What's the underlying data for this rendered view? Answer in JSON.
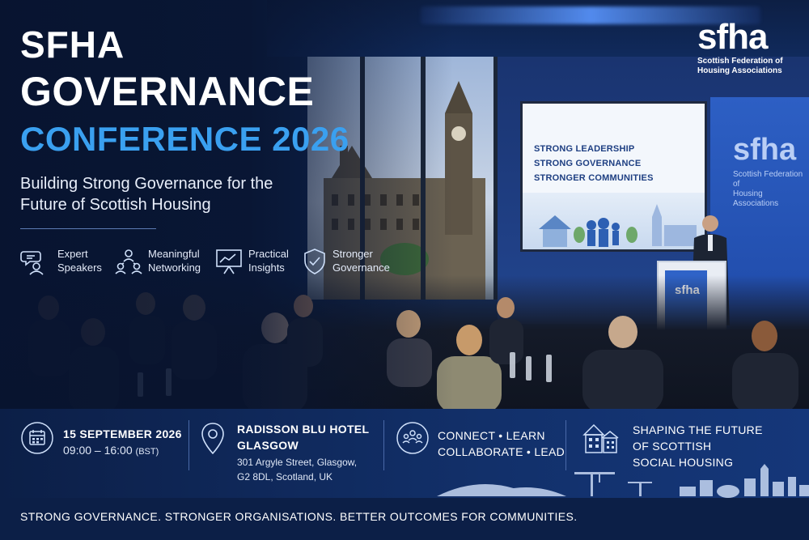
{
  "header": {
    "title_line1": "SFHA",
    "title_line2": "GOVERNANCE",
    "title_line3": "CONFERENCE 2026",
    "subtitle": "Building Strong Governance for the Future of Scottish Housing"
  },
  "features": [
    {
      "icon": "speakers-icon",
      "line1": "Expert",
      "line2": "Speakers"
    },
    {
      "icon": "network-icon",
      "line1": "Meaningful",
      "line2": "Networking"
    },
    {
      "icon": "presentation-icon",
      "line1": "Practical",
      "line2": "Insights"
    },
    {
      "icon": "shield-check-icon",
      "line1": "Stronger",
      "line2": "Governance"
    }
  ],
  "logo": {
    "mark": "sfha",
    "line1": "Scottish Federation of",
    "line2": "Housing Associations"
  },
  "stage": {
    "screen_lines": [
      "STRONG LEADERSHIP",
      "STRONG GOVERNANCE",
      "STRONGER COMMUNITIES"
    ],
    "banner_mark": "sfha",
    "banner_line1": "Scottish Federation of",
    "banner_line2": "Housing Associations",
    "podium_mark": "sfha"
  },
  "info": {
    "date": "15 SEPTEMBER 2026",
    "time": "09:00 – 16:00",
    "timezone": "(BST)",
    "venue_line1": "RADISSON BLU HOTEL",
    "venue_line2": "GLASGOW",
    "address_line1": "301 Argyle Street, Glasgow,",
    "address_line2": "G2 8DL, Scotland, UK",
    "themes_line1": "CONNECT • LEARN",
    "themes_line2": "COLLABORATE • LEAD",
    "future_line1": "SHAPING THE FUTURE",
    "future_line2": "OF SCOTTISH",
    "future_line3": "SOCIAL HOUSING"
  },
  "tagline": "STRONG GOVERNANCE.  STRONGER ORGANISATIONS.  BETTER OUTCOMES FOR COMMUNITIES.",
  "colors": {
    "accent": "#3aa0f0",
    "navy": "#0c1f47",
    "text": "#ffffff"
  }
}
